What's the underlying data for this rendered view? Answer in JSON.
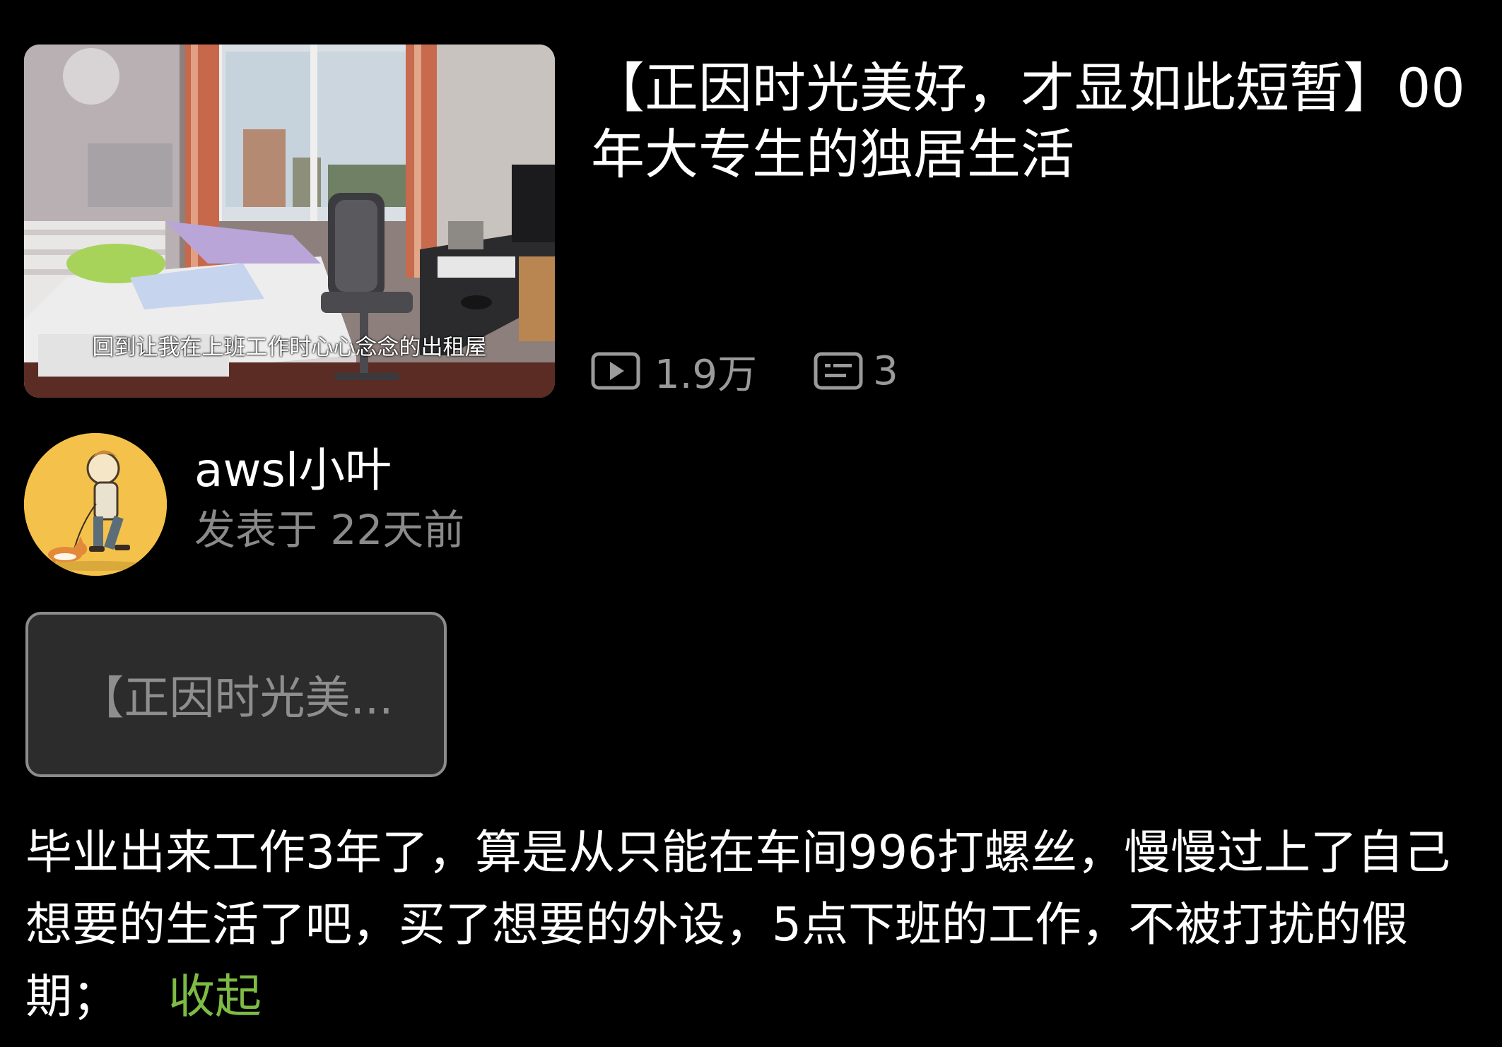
{
  "video": {
    "thumbnail_caption": "回到让我在上班工作时心心念念的出租屋",
    "title": "【正因时光美好，才显如此短暂】00年大专生的独居生活",
    "views": "1.9万",
    "comments": "3",
    "views_icon": "play-icon",
    "comments_icon": "danmaku-icon"
  },
  "author": {
    "name": "awsl小叶",
    "posted": "发表于 22天前",
    "avatar_color": "#f4c24a"
  },
  "title_chip": {
    "label": "【正因时光美..."
  },
  "description": {
    "text": "毕业出来工作3年了，算是从只能在车间996打螺丝，慢慢过上了自己想要的生活了吧，买了想要的外设，5点下班的工作，不被打扰的假期；",
    "collapse_label": "收起",
    "link_color": "#7dbb45"
  }
}
